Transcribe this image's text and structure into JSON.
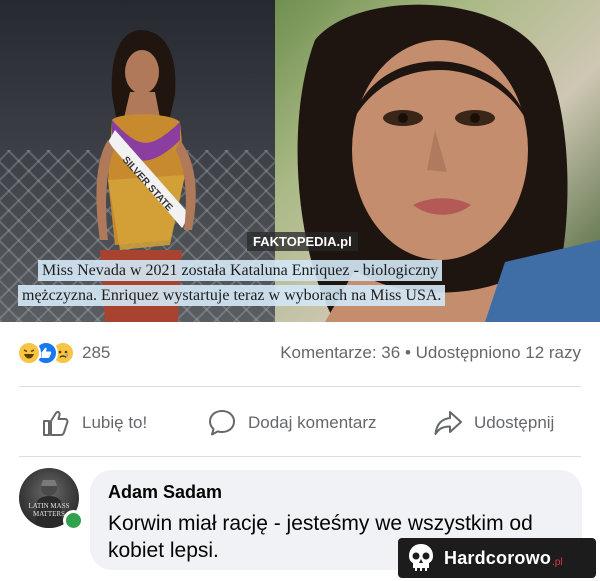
{
  "post": {
    "watermark": "FAKTOPEDIA.pl",
    "sash_text": "SILVER STATE",
    "caption_line1": "Miss Nevada w 2021 została Kataluna Enriquez - biologiczny",
    "caption_line2": "mężczyzna. Enriquez wystartuje teraz w wyborach na Miss USA."
  },
  "stats": {
    "reactions": [
      "haha-icon",
      "like-icon",
      "sad-icon"
    ],
    "reaction_count": "285",
    "comments_shares": "Komentarze: 36 • Udostępniono 12 razy"
  },
  "actions": {
    "like": "Lubię to!",
    "comment": "Dodaj komentarz",
    "share": "Udostępnij"
  },
  "comment": {
    "author": "Adam Sadam",
    "text": "Korwin miał rację - jesteśmy we wszystkim od kobiet lepsi.",
    "avatar_text": "LATIN MASS MATTERS",
    "online": true
  },
  "brand": {
    "name": "Hardcorowo",
    "tld": ".pl"
  },
  "colors": {
    "accent": "#1877f2",
    "text_secondary": "#65676b",
    "bubble_bg": "#f0f2f5",
    "online": "#31a24c",
    "caption_bg": "#d2e6f4"
  }
}
